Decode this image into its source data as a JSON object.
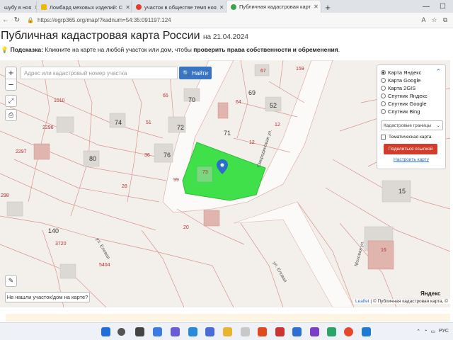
{
  "browser": {
    "tabs": [
      {
        "label": "шубу в ноя",
        "fav_color": "#e23c2c",
        "active": false
      },
      {
        "label": "Ломбард меховых изделий: С",
        "fav_color": "#f2b705",
        "active": false
      },
      {
        "label": "участок в обществе темп ноя",
        "fav_color": "#e23c2c",
        "active": false
      },
      {
        "label": "Публичная кадастровая карт",
        "fav_color": "#3fa34d",
        "active": true
      }
    ],
    "new_tab_icon": "plus-icon",
    "url": "https://egrp365.org/map/?kadnum=54:35:091197:124"
  },
  "page": {
    "title": "Публичная кадастровая карта России",
    "title_date": "на 21.04.2024",
    "hint_label": "Подсказка:",
    "hint_text": " Кликните на карте на любой участок или дом, чтобы ",
    "hint_bold": "проверить права собственности и обременения",
    "hint_end": "."
  },
  "map": {
    "search_placeholder": "Адрес или кадастровый номер участка",
    "search_button": "Найти",
    "zoom_in": "+",
    "zoom_out": "−",
    "not_found_button": "Не нашли участок/дом на карте?",
    "attribution_leaflet": "Leaflet",
    "attribution_rest": " | © Публичная кадастровая карта, ©",
    "yandex_logo": "Яндекс",
    "selected_color": "#3fe04a",
    "numbers": {
      "n67": "67",
      "n159": "159",
      "n1010": "1010",
      "n65": "65",
      "n70": "70",
      "n69": "69",
      "n52": "52",
      "n64": "64",
      "n74": "74",
      "n51": "51",
      "n72": "72",
      "n71": "71",
      "n12a": "12",
      "n12b": "12",
      "n2296": "2296",
      "n2297": "2297",
      "n80": "80",
      "n36": "36",
      "n76": "76",
      "n99": "99",
      "n28": "28",
      "n15": "15",
      "n298": "298",
      "n140": "140",
      "n20": "20",
      "n3720": "3720",
      "n16": "16",
      "n5404": "5404",
      "n73": "73"
    },
    "streets": {
      "s1": "Смородиновая ул.",
      "s2": "Моховая ул.",
      "s3": "ул. Еловая",
      "s4": "ул. Еловая"
    }
  },
  "layers_panel": {
    "options": [
      "Карта Яндекс",
      "Карта Google",
      "Карта 2GIS",
      "Спутник Яндекс",
      "Спутник Google",
      "Спутник Bing"
    ],
    "selected_index": 0,
    "boundaries_select": "Кадастровые границы",
    "thematic_label": "Тематическая карта",
    "share_button": "Поделиться ссылкой",
    "configure_link": "Настроить карту"
  },
  "taskbar": {
    "tray_lang": "РУС"
  }
}
